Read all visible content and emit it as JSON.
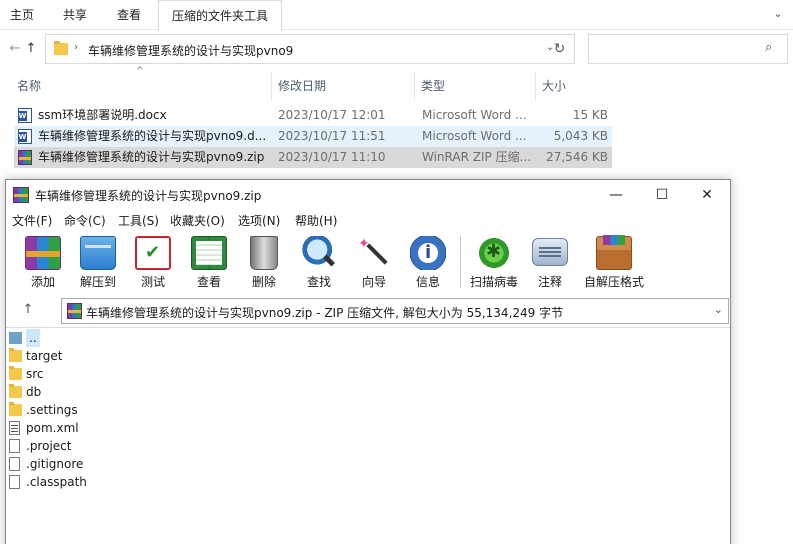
{
  "explorer": {
    "ribbon_tabs": [
      "主页",
      "共享",
      "查看",
      "压缩的文件夹工具"
    ],
    "address": {
      "path": "车辆维修管理系统的设计与实现pvno9"
    },
    "columns": {
      "name": "名称",
      "date": "修改日期",
      "type": "类型",
      "size": "大小"
    },
    "files": [
      {
        "name": "ssm环境部署说明.docx",
        "date": "2023/10/17 12:01",
        "type": "Microsoft Word ...",
        "size": "15 KB",
        "icon": "word-icon"
      },
      {
        "name": "车辆维修管理系统的设计与实现pvno9.d...",
        "date": "2023/10/17 11:51",
        "type": "Microsoft Word ...",
        "size": "5,043 KB",
        "icon": "word-icon"
      },
      {
        "name": "车辆维修管理系统的设计与实现pvno9.zip",
        "date": "2023/10/17 11:10",
        "type": "WinRAR ZIP 压缩...",
        "size": "27,546 KB",
        "icon": "rar-icon"
      }
    ]
  },
  "winrar": {
    "title": "车辆维修管理系统的设计与实现pvno9.zip",
    "window_buttons": {
      "minimize": "—",
      "maximize": "☐",
      "close": "✕"
    },
    "menu": [
      "文件(F)",
      "命令(C)",
      "工具(S)",
      "收藏夹(O)",
      "选项(N)",
      "帮助(H)"
    ],
    "toolbar": [
      {
        "label": "添加",
        "icon": "add-archive-icon"
      },
      {
        "label": "解压到",
        "icon": "extract-to-icon"
      },
      {
        "label": "测试",
        "icon": "test-icon"
      },
      {
        "label": "查看",
        "icon": "view-icon"
      },
      {
        "label": "删除",
        "icon": "delete-icon"
      },
      {
        "label": "查找",
        "icon": "find-icon"
      },
      {
        "label": "向导",
        "icon": "wizard-icon"
      },
      {
        "label": "信息",
        "icon": "info-icon"
      },
      {
        "label": "扫描病毒",
        "icon": "virus-scan-icon"
      },
      {
        "label": "注释",
        "icon": "comment-icon"
      },
      {
        "label": "自解压格式",
        "icon": "sfx-icon"
      }
    ],
    "path_text": "车辆维修管理系统的设计与实现pvno9.zip - ZIP 压缩文件, 解包大小为 55,134,249 字节",
    "entries": [
      {
        "name": "..",
        "kind": "up"
      },
      {
        "name": "target",
        "kind": "folder"
      },
      {
        "name": "src",
        "kind": "folder"
      },
      {
        "name": "db",
        "kind": "folder"
      },
      {
        "name": ".settings",
        "kind": "folder"
      },
      {
        "name": "pom.xml",
        "kind": "xml"
      },
      {
        "name": ".project",
        "kind": "file"
      },
      {
        "name": ".gitignore",
        "kind": "file"
      },
      {
        "name": ".classpath",
        "kind": "file"
      }
    ]
  }
}
